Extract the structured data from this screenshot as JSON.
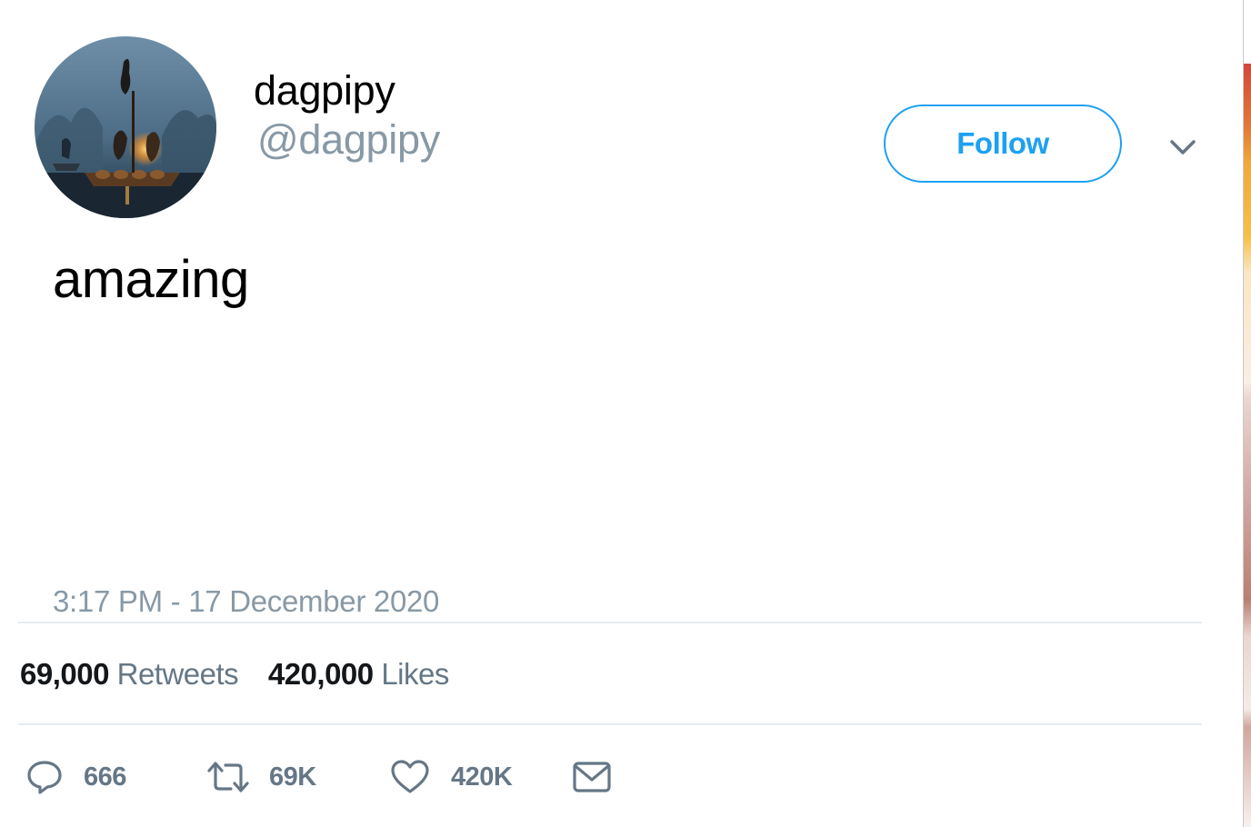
{
  "author": {
    "display_name": "dagpipy",
    "handle": "@dagpipy",
    "avatar": "cormorant-fisherman-raft-photo"
  },
  "follow_label": "Follow",
  "tweet": {
    "text": "amazing",
    "timestamp": "3:17 PM - 17 December 2020"
  },
  "stats": {
    "retweets_count": "69,000",
    "retweets_label": "Retweets",
    "likes_count": "420,000",
    "likes_label": "Likes"
  },
  "actions": {
    "reply": {
      "icon": "reply-icon",
      "count": "666"
    },
    "retweet": {
      "icon": "retweet-icon",
      "count": "69K"
    },
    "like": {
      "icon": "heart-icon",
      "count": "420K"
    },
    "dm": {
      "icon": "envelope-icon"
    }
  },
  "colors": {
    "accent": "#1da1f2",
    "muted_text": "#8899a6",
    "action_gray": "#657786",
    "divider": "#e6ecf0"
  }
}
